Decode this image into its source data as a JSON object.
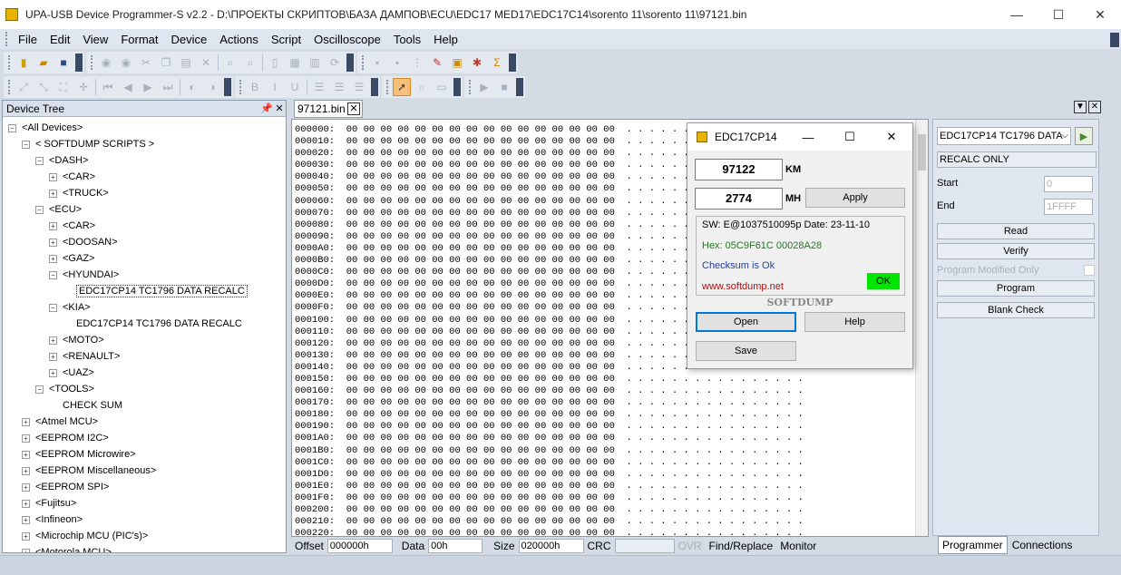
{
  "window": {
    "title": "UPA-USB Device Programmer-S v2.2 - D:\\ПРОЕКТЫ СКРИПТОВ\\БАЗА ДАМПОВ\\ECU\\EDC17 MED17\\EDC17C14\\sorento 11\\sorento 11\\97121.bin",
    "minimize": "—",
    "maximize": "☐",
    "close": "✕"
  },
  "menu": [
    "File",
    "Edit",
    "View",
    "Format",
    "Device",
    "Actions",
    "Script",
    "Oscilloscope",
    "Tools",
    "Help"
  ],
  "device_tree": {
    "title": "Device Tree",
    "pin": "📌",
    "close": "✕",
    "rows": [
      {
        "label": "<All Devices>",
        "level": 0,
        "toggle": "−"
      },
      {
        "label": "< SOFTDUMP SCRIPTS >",
        "level": 1,
        "toggle": "−"
      },
      {
        "label": "<DASH>",
        "level": 2,
        "toggle": "−"
      },
      {
        "label": "<CAR>",
        "level": 3,
        "toggle": "+"
      },
      {
        "label": "<TRUCK>",
        "level": 3,
        "toggle": "+"
      },
      {
        "label": "<ECU>",
        "level": 2,
        "toggle": "−"
      },
      {
        "label": "<CAR>",
        "level": 3,
        "toggle": "+"
      },
      {
        "label": "<DOOSAN>",
        "level": 3,
        "toggle": "+"
      },
      {
        "label": "<GAZ>",
        "level": 3,
        "toggle": "+"
      },
      {
        "label": "<HYUNDAI>",
        "level": 3,
        "toggle": "−"
      },
      {
        "label": "EDC17CP14 TC1796 DATA RECALC",
        "level": 4,
        "toggle": "",
        "selected": true
      },
      {
        "label": "<KIA>",
        "level": 3,
        "toggle": "−"
      },
      {
        "label": "EDC17CP14 TC1796 DATA RECALC",
        "level": 4,
        "toggle": ""
      },
      {
        "label": "<MOTO>",
        "level": 3,
        "toggle": "+"
      },
      {
        "label": "<RENAULT>",
        "level": 3,
        "toggle": "+"
      },
      {
        "label": "<UAZ>",
        "level": 3,
        "toggle": "+"
      },
      {
        "label": "<TOOLS>",
        "level": 2,
        "toggle": "−"
      },
      {
        "label": "CHECK SUM",
        "level": 3,
        "toggle": ""
      },
      {
        "label": "<Atmel MCU>",
        "level": 1,
        "toggle": "+"
      },
      {
        "label": "<EEPROM I2C>",
        "level": 1,
        "toggle": "+"
      },
      {
        "label": "<EEPROM Microwire>",
        "level": 1,
        "toggle": "+"
      },
      {
        "label": "<EEPROM Miscellaneous>",
        "level": 1,
        "toggle": "+"
      },
      {
        "label": "<EEPROM SPI>",
        "level": 1,
        "toggle": "+"
      },
      {
        "label": "<Fujitsu>",
        "level": 1,
        "toggle": "+"
      },
      {
        "label": "<Infineon>",
        "level": 1,
        "toggle": "+"
      },
      {
        "label": "<Microchip MCU (PIC's)>",
        "level": 1,
        "toggle": "+"
      },
      {
        "label": "<Motorola MCU>",
        "level": 1,
        "toggle": "+"
      }
    ]
  },
  "doc_tab": {
    "label": "97121.bin",
    "close": "✕"
  },
  "hex": {
    "addresses": [
      "000000:",
      "000010:",
      "000020:",
      "000030:",
      "000040:",
      "000050:",
      "000060:",
      "000070:",
      "000080:",
      "000090:",
      "0000A0:",
      "0000B0:",
      "0000C0:",
      "0000D0:",
      "0000E0:",
      "0000F0:",
      "000100:",
      "000110:",
      "000120:",
      "000130:",
      "000140:",
      "000150:",
      "000160:",
      "000170:",
      "000180:",
      "000190:",
      "0001A0:",
      "0001B0:",
      "0001C0:",
      "0001D0:",
      "0001E0:",
      "0001F0:",
      "000200:",
      "000210:",
      "000220:"
    ],
    "bytes": "00 00 00 00 00 00 00 00 00 00 00 00 00 00 00 00",
    "ascii": ". . . . . . . . . . . . . . . ."
  },
  "status": {
    "offset_label": "Offset",
    "offset_value": "000000h",
    "data_label": "Data",
    "data_value": "00h",
    "size_label": "Size",
    "size_value": "020000h",
    "crc_label": "CRC",
    "crc_value": "",
    "ovr": "OVR",
    "find_replace": "Find/Replace",
    "monitor": "Monitor"
  },
  "right_panel": {
    "device_combo": "EDC17CP14 TC1796 DATA",
    "mode": "RECALC ONLY",
    "start_label": "Start",
    "start_value": "0",
    "end_label": "End",
    "end_value": "1FFFF",
    "read": "Read",
    "verify": "Verify",
    "program_modified_only": "Program Modified Only",
    "program": "Program",
    "blank_check": "Blank Check",
    "tabs": [
      "Programmer",
      "Connections"
    ]
  },
  "dialog": {
    "title": "EDC17CP14",
    "km_value": "97122",
    "km_unit": "KM",
    "mh_value": "2774",
    "mh_unit": "MH",
    "apply": "Apply",
    "sw_line": "SW: E@1037510095p  Date: 23-11-10",
    "hex_line": "Hex: 05C9F61C 00028A28",
    "checksum": "Checksum is Ok",
    "url": "www.softdump.net",
    "ok_badge": "OK",
    "brand": "SOFTDUMP",
    "open": "Open",
    "help": "Help",
    "save": "Save"
  },
  "colors": {
    "accent": "#0078d7",
    "ok_green": "#00e600",
    "hex_green": "#1e7a1e",
    "checksum_blue": "#1f3fa0",
    "url_red": "#b01010"
  }
}
